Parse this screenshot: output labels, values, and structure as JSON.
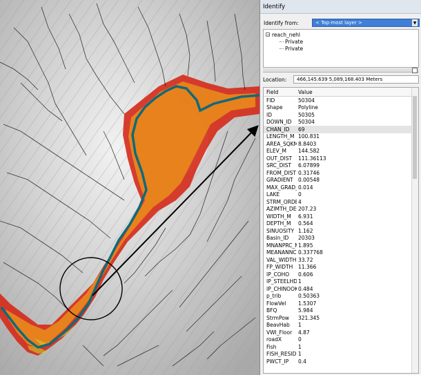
{
  "window": {
    "title": "Identify"
  },
  "identify_from": {
    "label": "Identify from:",
    "value": "< Top-most layer >"
  },
  "tree": {
    "root": "reach_nehl",
    "children": [
      "Private",
      "Private"
    ]
  },
  "location": {
    "label": "Location:",
    "value": "466,145.639  5,089,168.403 Meters"
  },
  "grid": {
    "headers": {
      "field": "Field",
      "value": "Value"
    },
    "selected_field": "CHAN_ID",
    "rows": [
      {
        "f": "FID",
        "v": "50304"
      },
      {
        "f": "Shape",
        "v": "Polyline"
      },
      {
        "f": "ID",
        "v": "50305"
      },
      {
        "f": "DOWN_ID",
        "v": "50304"
      },
      {
        "f": "CHAN_ID",
        "v": "69"
      },
      {
        "f": "LENGTH_M",
        "v": "100.831"
      },
      {
        "f": "AREA_SQKM",
        "v": "8.8403"
      },
      {
        "f": "ELEV_M",
        "v": "144.582"
      },
      {
        "f": "OUT_DIST",
        "v": "111.36113"
      },
      {
        "f": "SRC_DIST",
        "v": "6.07899"
      },
      {
        "f": "FROM_DIST",
        "v": "0.31746"
      },
      {
        "f": "GRADIENT",
        "v": "0.00548"
      },
      {
        "f": "MAX_GRAD_D",
        "v": "0.014"
      },
      {
        "f": "LAKE",
        "v": "0"
      },
      {
        "f": "STRM_ORDER",
        "v": "4"
      },
      {
        "f": "AZIMTH_DEG",
        "v": "207.23"
      },
      {
        "f": "WIDTH_M",
        "v": "6.931"
      },
      {
        "f": "DEPTH_M",
        "v": "0.564"
      },
      {
        "f": "SINUOSITY",
        "v": "1.162"
      },
      {
        "f": "Basin_ID",
        "v": "20303"
      },
      {
        "f": "MNANPRC_M",
        "v": "1.895"
      },
      {
        "f": "MEANANNCMS",
        "v": "0.337768"
      },
      {
        "f": "VAL_WIDTH",
        "v": "33.72"
      },
      {
        "f": "FP_WIDTH",
        "v": "11.366"
      },
      {
        "f": "IP_COHO",
        "v": "0.606"
      },
      {
        "f": "IP_STEELHD",
        "v": "1"
      },
      {
        "f": "IP_CHINOOK",
        "v": "0.484"
      },
      {
        "f": "p_trib",
        "v": "0.50363"
      },
      {
        "f": "FlowVel",
        "v": "1.5307"
      },
      {
        "f": "BFQ",
        "v": "5.984"
      },
      {
        "f": "StrmPow",
        "v": "321.345"
      },
      {
        "f": "BeavHab",
        "v": "1"
      },
      {
        "f": "VWI_Floor",
        "v": "4.87"
      },
      {
        "f": "roadX",
        "v": "0"
      },
      {
        "f": "Fish",
        "v": "1"
      },
      {
        "f": "FISH_RESID",
        "v": "1"
      },
      {
        "f": "PWCT_IP",
        "v": "0.4"
      }
    ]
  },
  "map": {
    "colors": {
      "floodplain_outer": "#d42a1a",
      "floodplain_inner": "#e98a1c",
      "floodplain_core": "#c8d22a",
      "channel": "#0f6a78",
      "streams": "#1a1a1a",
      "terrain": "#d9d9d9"
    },
    "icons": [
      "callout-circle",
      "callout-arrow"
    ]
  }
}
